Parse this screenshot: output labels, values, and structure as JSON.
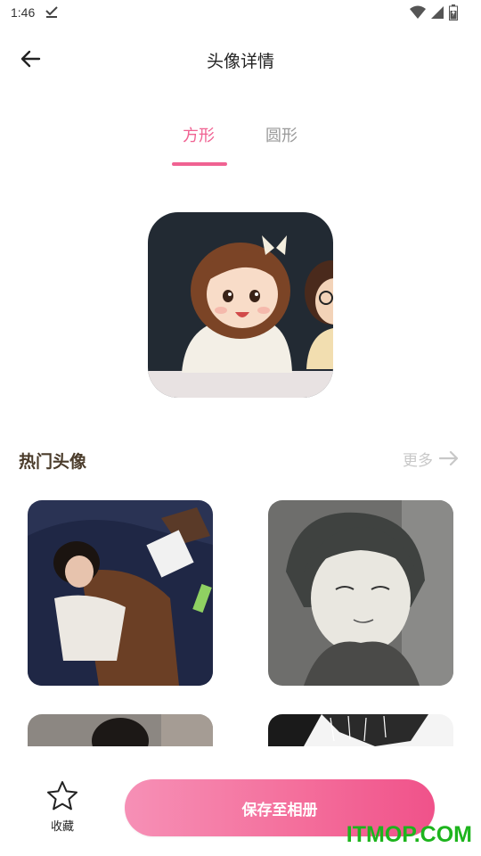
{
  "status_bar": {
    "time": "1:46",
    "icons": [
      "download-done-icon",
      "wifi-icon",
      "signal-icon",
      "battery-icon"
    ]
  },
  "header": {
    "title": "头像详情",
    "back_icon": "arrow-left-icon"
  },
  "tabs": [
    {
      "label": "方形",
      "active": true
    },
    {
      "label": "圆形",
      "active": false
    }
  ],
  "colors": {
    "accent": "#f06292",
    "tab_inactive": "#9a9a9a",
    "section_title": "#4a3b2a",
    "more": "#c8c8c8",
    "watermark": "#1db41d"
  },
  "hot_section": {
    "title": "热门头像",
    "more_label": "更多",
    "more_icon": "arrow-right-icon"
  },
  "bottom": {
    "favorite_label": "收藏",
    "favorite_icon": "star-outline-icon",
    "save_label": "保存至相册"
  },
  "watermark": "ITMOP.COM"
}
